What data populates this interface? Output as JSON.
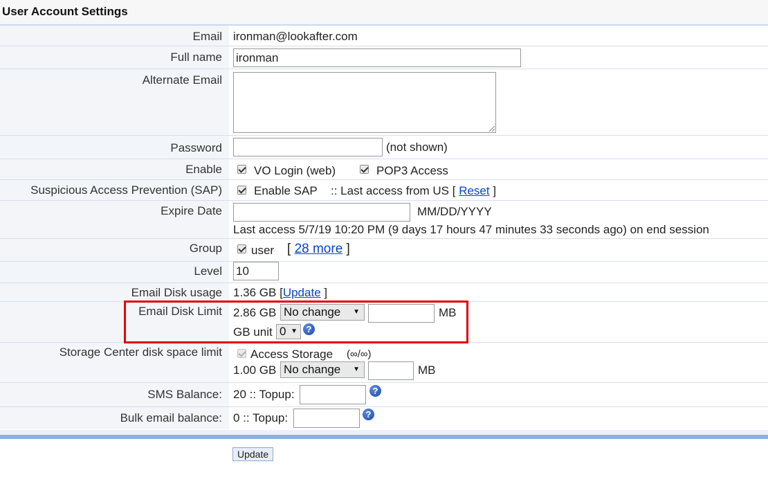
{
  "header": {
    "title": "User Account Settings"
  },
  "email": {
    "label": "Email",
    "value": "ironman@lookafter.com"
  },
  "fullname": {
    "label": "Full name",
    "value": "ironman"
  },
  "alt_email": {
    "label": "Alternate Email",
    "value": ""
  },
  "password": {
    "label": "Password",
    "value": "",
    "note": "(not shown)"
  },
  "enable": {
    "label": "Enable",
    "vo_login": "VO Login (web)",
    "pop3": "POP3 Access"
  },
  "sap": {
    "label": "Suspicious Access Prevention (SAP)",
    "enable": "Enable SAP",
    "last_access_prefix": ":: Last access from US [",
    "reset": "Reset",
    "close": "]"
  },
  "expire": {
    "label": "Expire Date",
    "value": "",
    "format": "MM/DD/YYYY",
    "last_access": "Last access 5/7/19 10:20 PM (9 days 17 hours 47 minutes 33 seconds ago) on end session"
  },
  "group": {
    "label": "Group",
    "item": "user",
    "open": "[",
    "more": "28 more",
    "close": "]"
  },
  "level": {
    "label": "Level",
    "value": "10"
  },
  "disk_usage": {
    "label": "Email Disk usage",
    "value": "1.36 GB [",
    "update": "Update",
    "close": "]"
  },
  "disk_limit": {
    "label": "Email Disk Limit",
    "current": "2.86 GB",
    "select": "No change",
    "mb_value": "",
    "mb": "MB",
    "gb_unit_label": "GB unit",
    "gb_unit_value": "0"
  },
  "storage": {
    "label": "Storage Center disk space limit",
    "access": "Access Storage",
    "infinity": "(∞/∞)",
    "current": "1.00 GB",
    "select": "No change",
    "mb_value": "",
    "mb": "MB"
  },
  "sms": {
    "label": "SMS Balance:",
    "value": "20 :: Topup:",
    "topup": ""
  },
  "bulk": {
    "label": "Bulk email balance:",
    "value": "0 :: Topup:",
    "topup": ""
  },
  "footer": {
    "update_button": "Update"
  },
  "icons": {
    "help": "help-icon",
    "dropdown": "chevron-down-icon"
  },
  "colors": {
    "link": "#0645c6",
    "highlight": "#e00000",
    "label_bg": "#f3f5f9"
  }
}
